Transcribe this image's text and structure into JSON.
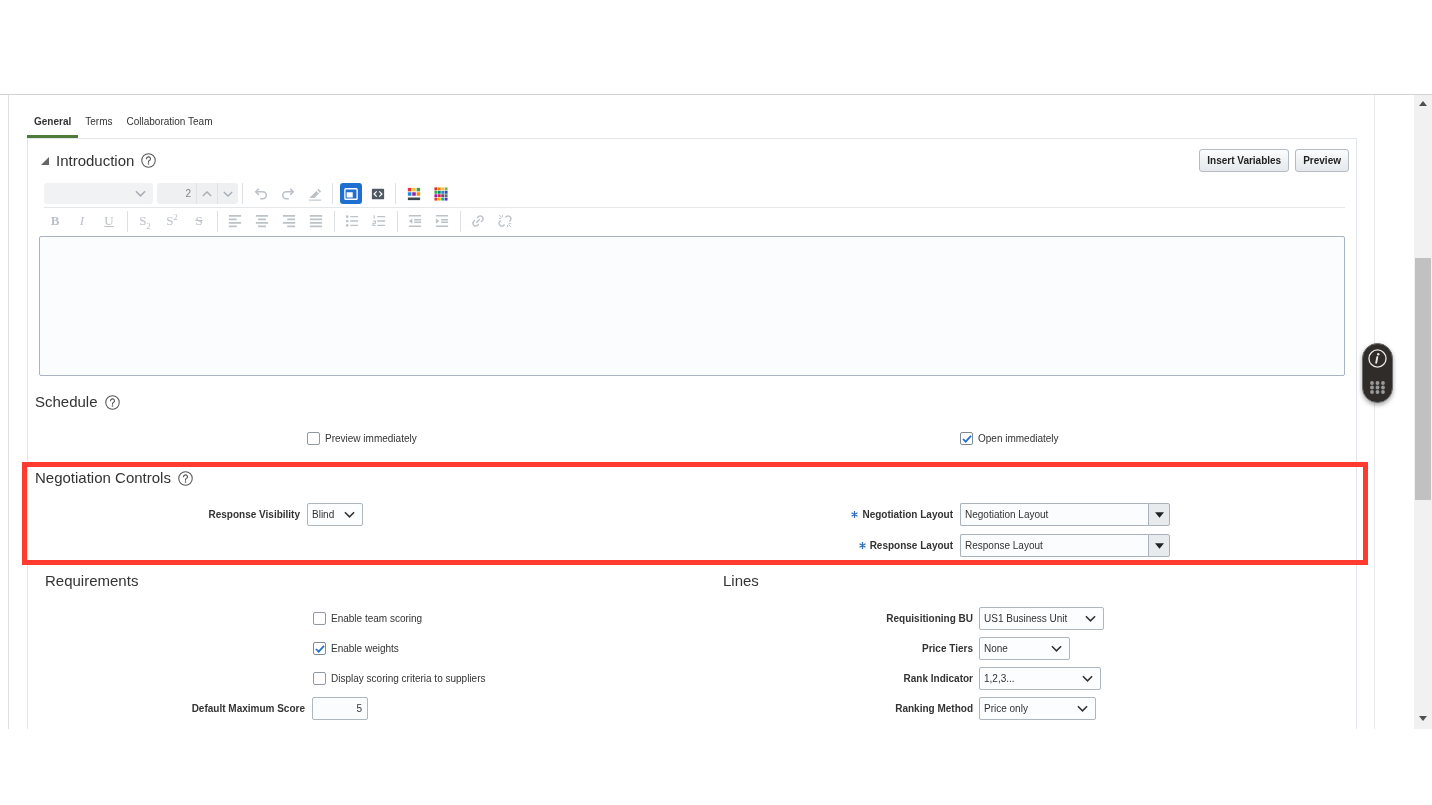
{
  "tabs": [
    {
      "label": "General",
      "selected": true
    },
    {
      "label": "Terms",
      "selected": false
    },
    {
      "label": "Collaboration Team",
      "selected": false
    }
  ],
  "introduction": {
    "title": "Introduction",
    "expanded": true,
    "buttons": [
      "Insert Variables",
      "Preview"
    ],
    "toolbar": {
      "font_select": {
        "disabled": true
      },
      "font_size": {
        "value": "2",
        "disabled": true
      },
      "top_groups": [
        [
          {
            "kind": "undo",
            "disabled": true,
            "selected": false
          },
          {
            "kind": "redo",
            "disabled": true,
            "selected": false
          },
          {
            "kind": "clear-formatting",
            "disabled": true,
            "selected": false
          }
        ],
        [
          {
            "kind": "design-view",
            "disabled": false,
            "selected": true
          },
          {
            "kind": "source-view",
            "disabled": false,
            "selected": false
          }
        ],
        [
          {
            "kind": "text-color",
            "disabled": false,
            "selected": false
          },
          {
            "kind": "background-color",
            "disabled": false,
            "selected": false
          }
        ]
      ],
      "bottom_groups": [
        [
          {
            "kind": "bold",
            "label": "B",
            "disabled": true,
            "selected": false
          },
          {
            "kind": "italic",
            "label": "I",
            "disabled": true,
            "selected": false
          },
          {
            "kind": "underline",
            "label": "U",
            "disabled": true,
            "selected": false
          }
        ],
        [
          {
            "kind": "subscript",
            "label": "S$_{2}$",
            "disabled": true,
            "selected": false
          },
          {
            "kind": "superscript",
            "label": "S$^{2}$",
            "disabled": true,
            "selected": false
          },
          {
            "kind": "strikethrough",
            "label": "S",
            "disabled": true,
            "selected": false
          }
        ],
        [
          {
            "kind": "align-left",
            "disabled": true,
            "selected": false
          },
          {
            "kind": "align-center",
            "disabled": true,
            "selected": false
          },
          {
            "kind": "align-right",
            "disabled": true,
            "selected": false
          },
          {
            "kind": "justify",
            "disabled": true,
            "selected": false
          }
        ],
        [
          {
            "kind": "bullet-list",
            "disabled": true,
            "selected": false
          },
          {
            "kind": "numbered-list",
            "disabled": true,
            "selected": false
          }
        ],
        [
          {
            "kind": "outdent",
            "disabled": true,
            "selected": false
          },
          {
            "kind": "indent",
            "disabled": true,
            "selected": false
          }
        ],
        [
          {
            "kind": "link",
            "disabled": true,
            "selected": false
          },
          {
            "kind": "unlink",
            "disabled": true,
            "selected": false
          }
        ]
      ]
    }
  },
  "schedule": {
    "title": "Schedule",
    "options": [
      {
        "label": "Preview immediately",
        "checked": false
      },
      {
        "label": "Open immediately",
        "checked": true
      }
    ]
  },
  "negotiation_controls": {
    "title": "Negotiation Controls",
    "highlighted": true,
    "fields_left": [
      {
        "label": "Response Visibility",
        "kind": "select",
        "value": "Blind",
        "required": false
      }
    ],
    "fields_right": [
      {
        "label": "Negotiation Layout",
        "kind": "combobox",
        "value": "Negotiation Layout",
        "required": true
      },
      {
        "label": "Response Layout",
        "kind": "combobox",
        "value": "Response Layout",
        "required": true
      }
    ]
  },
  "requirements": {
    "title": "Requirements",
    "options": [
      {
        "label": "Enable team scoring",
        "checked": false
      },
      {
        "label": "Enable weights",
        "checked": true
      },
      {
        "label": "Display scoring criteria to suppliers",
        "checked": false
      }
    ],
    "fields": [
      {
        "label": "Default Maximum Score",
        "kind": "number",
        "value": "5",
        "required": false
      }
    ]
  },
  "lines": {
    "title": "Lines",
    "fields": [
      {
        "label": "Requisitioning BU",
        "kind": "select",
        "value": "US1 Business Unit",
        "required": false
      },
      {
        "label": "Price Tiers",
        "kind": "select",
        "value": "None",
        "required": false
      },
      {
        "label": "Rank Indicator",
        "kind": "select",
        "value": "1,2,3...",
        "required": false
      },
      {
        "label": "Ranking Method",
        "kind": "select",
        "value": "Price only",
        "required": false
      }
    ]
  }
}
